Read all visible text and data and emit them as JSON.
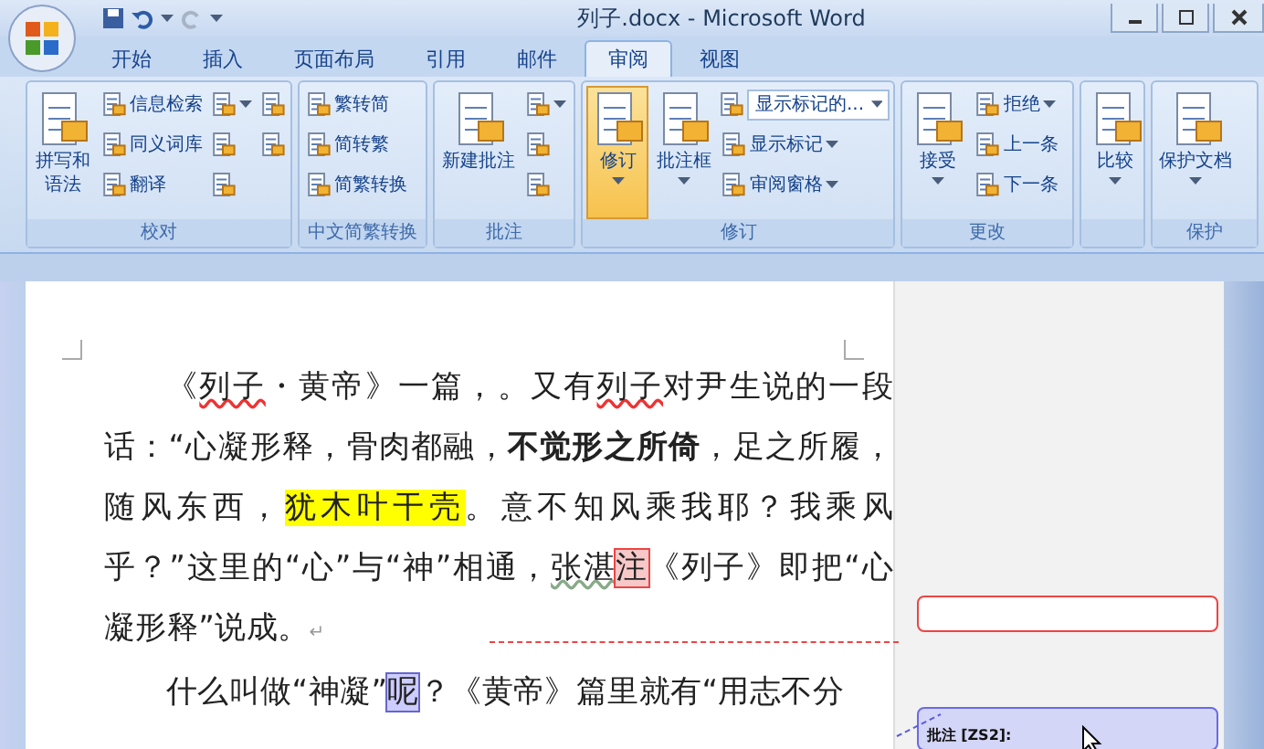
{
  "window": {
    "title": "列子.docx - Microsoft Word"
  },
  "tabs": [
    {
      "label": "开始",
      "selected": false
    },
    {
      "label": "插入",
      "selected": false
    },
    {
      "label": "页面布局",
      "selected": false
    },
    {
      "label": "引用",
      "selected": false
    },
    {
      "label": "邮件",
      "selected": false
    },
    {
      "label": "审阅",
      "selected": true
    },
    {
      "label": "视图",
      "selected": false
    }
  ],
  "ribbon_groups": [
    {
      "name": "校对",
      "items": [
        {
          "kind": "large",
          "label": "拼写和语法",
          "has_menu": false,
          "active": false
        },
        {
          "kind": "small",
          "label": "信息检索",
          "has_menu": false
        },
        {
          "kind": "small",
          "label": "同义词库",
          "has_menu": false
        },
        {
          "kind": "small",
          "label": "翻译",
          "has_menu": false
        },
        {
          "kind": "icon",
          "has_menu": true
        },
        {
          "kind": "icon",
          "has_menu": false
        },
        {
          "kind": "icon",
          "has_menu": false
        },
        {
          "kind": "icon",
          "has_menu": false
        },
        {
          "kind": "icon",
          "has_menu": false
        }
      ]
    },
    {
      "name": "中文简繁转换",
      "items": [
        {
          "kind": "small",
          "label": "繁转简",
          "has_menu": false
        },
        {
          "kind": "small",
          "label": "简转繁",
          "has_menu": false
        },
        {
          "kind": "small",
          "label": "简繁转换",
          "has_menu": false
        }
      ]
    },
    {
      "name": "批注",
      "items": [
        {
          "kind": "large",
          "label": "新建批注",
          "has_menu": false,
          "active": false
        },
        {
          "kind": "icon",
          "has_menu": true
        },
        {
          "kind": "icon",
          "has_menu": false
        },
        {
          "kind": "icon",
          "has_menu": false
        }
      ]
    },
    {
      "name": "修订",
      "items": [
        {
          "kind": "large",
          "label": "修订",
          "has_menu": true,
          "active": true
        },
        {
          "kind": "large",
          "label": "批注框",
          "has_menu": true,
          "active": false
        },
        {
          "kind": "dropdown",
          "value": "显示标记的..."
        },
        {
          "kind": "small",
          "label": "显示标记",
          "has_menu": true
        },
        {
          "kind": "small",
          "label": "审阅窗格",
          "has_menu": true
        }
      ]
    },
    {
      "name": "更改",
      "items": [
        {
          "kind": "large",
          "label": "接受",
          "has_menu": true,
          "active": false
        },
        {
          "kind": "small",
          "label": "拒绝",
          "has_menu": true
        },
        {
          "kind": "small",
          "label": "上一条",
          "has_menu": false
        },
        {
          "kind": "small",
          "label": "下一条",
          "has_menu": false
        }
      ]
    },
    {
      "items": [
        {
          "kind": "large",
          "label": "比较",
          "has_menu": true,
          "active": false
        }
      ]
    },
    {
      "name": "保护",
      "items": [
        {
          "kind": "large",
          "label": "保护文档",
          "has_menu": true,
          "active": false
        }
      ]
    }
  ],
  "document": {
    "paragraphs": [
      {
        "runs": [
          {
            "kind": "plain",
            "text": "《"
          },
          {
            "kind": "spelling",
            "text": "列子"
          },
          {
            "kind": "plain",
            "text": "・黄帝》一篇，。又有"
          },
          {
            "kind": "spelling",
            "text": "列子"
          },
          {
            "kind": "plain",
            "text": "对尹生说的一段话：“心凝形释，骨肉都融，"
          },
          {
            "kind": "bold",
            "text": "不觉形之所倚"
          },
          {
            "kind": "plain",
            "text": "，足之所履，随风东西，"
          },
          {
            "kind": "highlight",
            "text": "犹木叶干壳"
          },
          {
            "kind": "plain",
            "text": "。意不知风乘我耶？我乘风乎？”这里的“心”与“神”相通，"
          },
          {
            "kind": "grammar",
            "text": "张湛"
          },
          {
            "kind": "comment_red",
            "text": "注"
          },
          {
            "kind": "plain",
            "text": "《列子》即把“心凝形释”说成。"
          },
          {
            "kind": "mark",
            "text": "↵"
          }
        ]
      },
      {
        "runs": [
          {
            "kind": "plain",
            "text": "什么叫做“神凝”"
          },
          {
            "kind": "comment_blue",
            "text": "呢"
          },
          {
            "kind": "plain",
            "text": "？《黄帝》篇里就有“用志不分"
          }
        ]
      }
    ],
    "comments": [
      {
        "kind": "red"
      },
      {
        "kind": "blue",
        "label": "批注 [ZS2]:"
      }
    ]
  }
}
